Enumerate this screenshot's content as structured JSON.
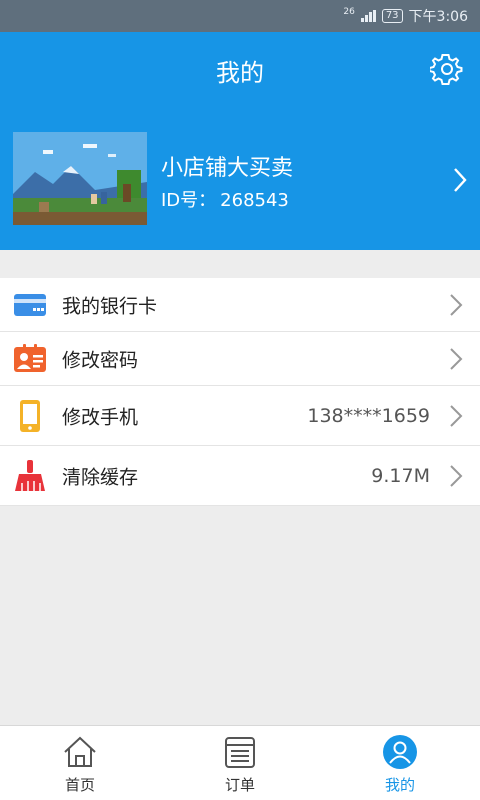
{
  "status_bar": {
    "network": "26",
    "battery": "73",
    "time": "下午3:06"
  },
  "header": {
    "title": "我的",
    "profile": {
      "shop_name": "小店铺大买卖",
      "id_label": "ID号：",
      "id_value": "268543"
    }
  },
  "menu": [
    {
      "label": "我的银行卡",
      "value": "",
      "icon": "bank-card-icon"
    },
    {
      "label": "修改密码",
      "value": "",
      "icon": "id-card-icon"
    },
    {
      "label": "修改手机",
      "value": "138****1659",
      "icon": "phone-icon"
    },
    {
      "label": "清除缓存",
      "value": "9.17M",
      "icon": "broom-icon"
    }
  ],
  "tabbar": [
    {
      "label": "首页",
      "icon": "home-icon"
    },
    {
      "label": "订单",
      "icon": "order-list-icon"
    },
    {
      "label": "我的",
      "icon": "user-icon",
      "active": true
    }
  ],
  "colors": {
    "primary": "#1795e6",
    "bank": "#3a8ee6",
    "password": "#f0632d",
    "phone": "#f4b227",
    "cache": "#e8333a"
  }
}
